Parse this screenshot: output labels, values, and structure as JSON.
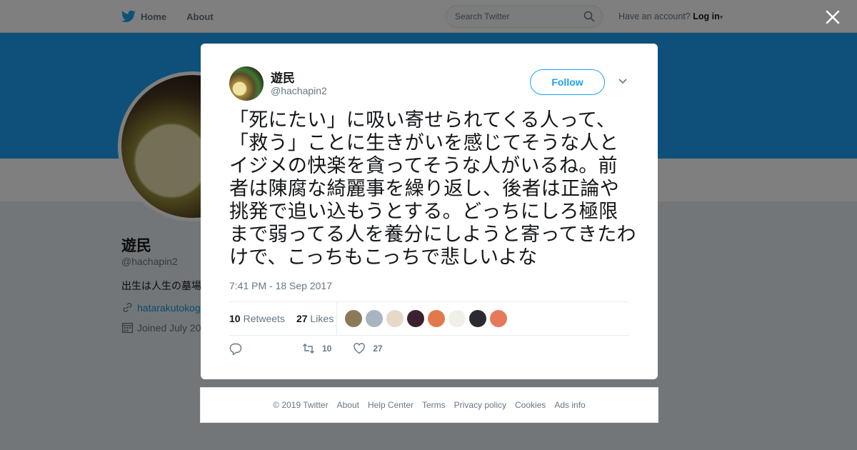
{
  "nav": {
    "home_label": "Home",
    "about_label": "About",
    "search_placeholder": "Search Twitter",
    "account_prompt": "Have an account?",
    "login_label": "Log in"
  },
  "profile": {
    "name": "遊民",
    "handle": "@hachapin2",
    "bio": "出生は人生の墓場",
    "link": "hatarakutokog",
    "joined": "Joined July 20"
  },
  "tweet": {
    "author_name": "遊民",
    "author_handle": "@hachapin2",
    "follow_label": "Follow",
    "text": "「死にたい」に吸い寄せられてくる人って、「救う」ことに生きがいを感じてそうな人とイジメの快楽を貪ってそうな人がいるね。前者は陳腐な綺麗事を繰り返し、後者は正論や挑発で追い込もうとする。どっちにしろ極限まで弱ってる人を養分にしようと寄ってきたわけで、こっちもこっちで悲しいよな",
    "timestamp": "7:41 PM - 18 Sep 2017",
    "retweets_count": "10",
    "retweets_label": "Retweets",
    "likes_count": "27",
    "likes_label": "Likes",
    "action_retweets": "10",
    "action_likes": "27"
  },
  "likers": [
    {
      "name": "liker-1",
      "color": "#8a7a5a"
    },
    {
      "name": "liker-2",
      "color": "#a8b4c0"
    },
    {
      "name": "liker-3",
      "color": "#e8d8c8"
    },
    {
      "name": "liker-4",
      "color": "#3a2030"
    },
    {
      "name": "liker-5",
      "color": "#e07a4a"
    },
    {
      "name": "liker-6",
      "color": "#f0f0e8"
    },
    {
      "name": "liker-7",
      "color": "#2a2a30"
    },
    {
      "name": "liker-8",
      "color": "#e8785a"
    }
  ],
  "footer": {
    "copyright": "© 2019 Twitter",
    "about": "About",
    "help": "Help Center",
    "terms": "Terms",
    "privacy": "Privacy policy",
    "cookies": "Cookies",
    "ads": "Ads info"
  },
  "colors": {
    "brand": "#1da1f2",
    "overlay": "rgba(0,0,0,0.5)"
  }
}
